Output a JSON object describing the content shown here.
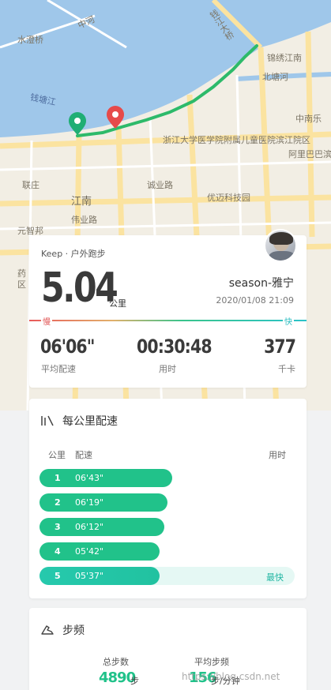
{
  "map": {
    "labels": {
      "zhonghe": "中河",
      "shuicheng": "水澄桥",
      "qianjiang_bridge": "钱江大桥",
      "jinxiu": "锦绣江南",
      "beitang": "北塘河",
      "qiantang": "钱塘江",
      "zhongnan": "中南乐",
      "hospital": "浙江大学医学院附属儿童医院滨江院区",
      "alibaba": "阿里巴巴滨江园区",
      "lianzhuang": "联庄",
      "jiangnan": "江南",
      "chengye": "诚业路",
      "youxun": "优迈科技园",
      "weiye": "伟业路",
      "yuanzhi": "元智邦",
      "yao": "药",
      "qu": "区"
    },
    "colors": {
      "water": "#9fc7ea",
      "land": "#f2eee4",
      "road": "#fbe6a4",
      "route": "#2dba6a",
      "start_pin": "#1fae74",
      "end_pin": "#e64a4a"
    }
  },
  "summary": {
    "source": "Keep · 户外跑步",
    "distance": "5.04",
    "distance_unit": "公里",
    "username": "season-雅宁",
    "datetime": "2020/01/08 21:09",
    "slow_label": "慢",
    "fast_label": "快",
    "avg_pace": {
      "value": "06'06\"",
      "label": "平均配速"
    },
    "duration": {
      "value": "00:30:48",
      "label": "用时"
    },
    "calories": {
      "value": "377",
      "label": "千卡"
    }
  },
  "pace_card": {
    "title": "每公里配速",
    "icon": "pace-split-icon",
    "columns": {
      "km": "公里",
      "pace": "配速",
      "time": "用时"
    },
    "fastest_label": "最快",
    "rows": [
      {
        "km": "1",
        "pace": "06'43\"",
        "fill": 0.52
      },
      {
        "km": "2",
        "pace": "06'19\"",
        "fill": 0.5
      },
      {
        "km": "3",
        "pace": "06'12\"",
        "fill": 0.49
      },
      {
        "km": "4",
        "pace": "05'42\"",
        "fill": 0.47
      },
      {
        "km": "5",
        "pace": "05'37\"",
        "fill": 0.47,
        "fastest": true
      }
    ]
  },
  "cadence_card": {
    "title": "步频",
    "icon": "shoe-icon",
    "total_steps": {
      "label": "总步数",
      "value": "4890",
      "unit": "步"
    },
    "avg_cadence": {
      "label": "平均步频",
      "value": "156",
      "unit": "步/分钟"
    }
  },
  "watermark": "https://blog.csdn.net"
}
